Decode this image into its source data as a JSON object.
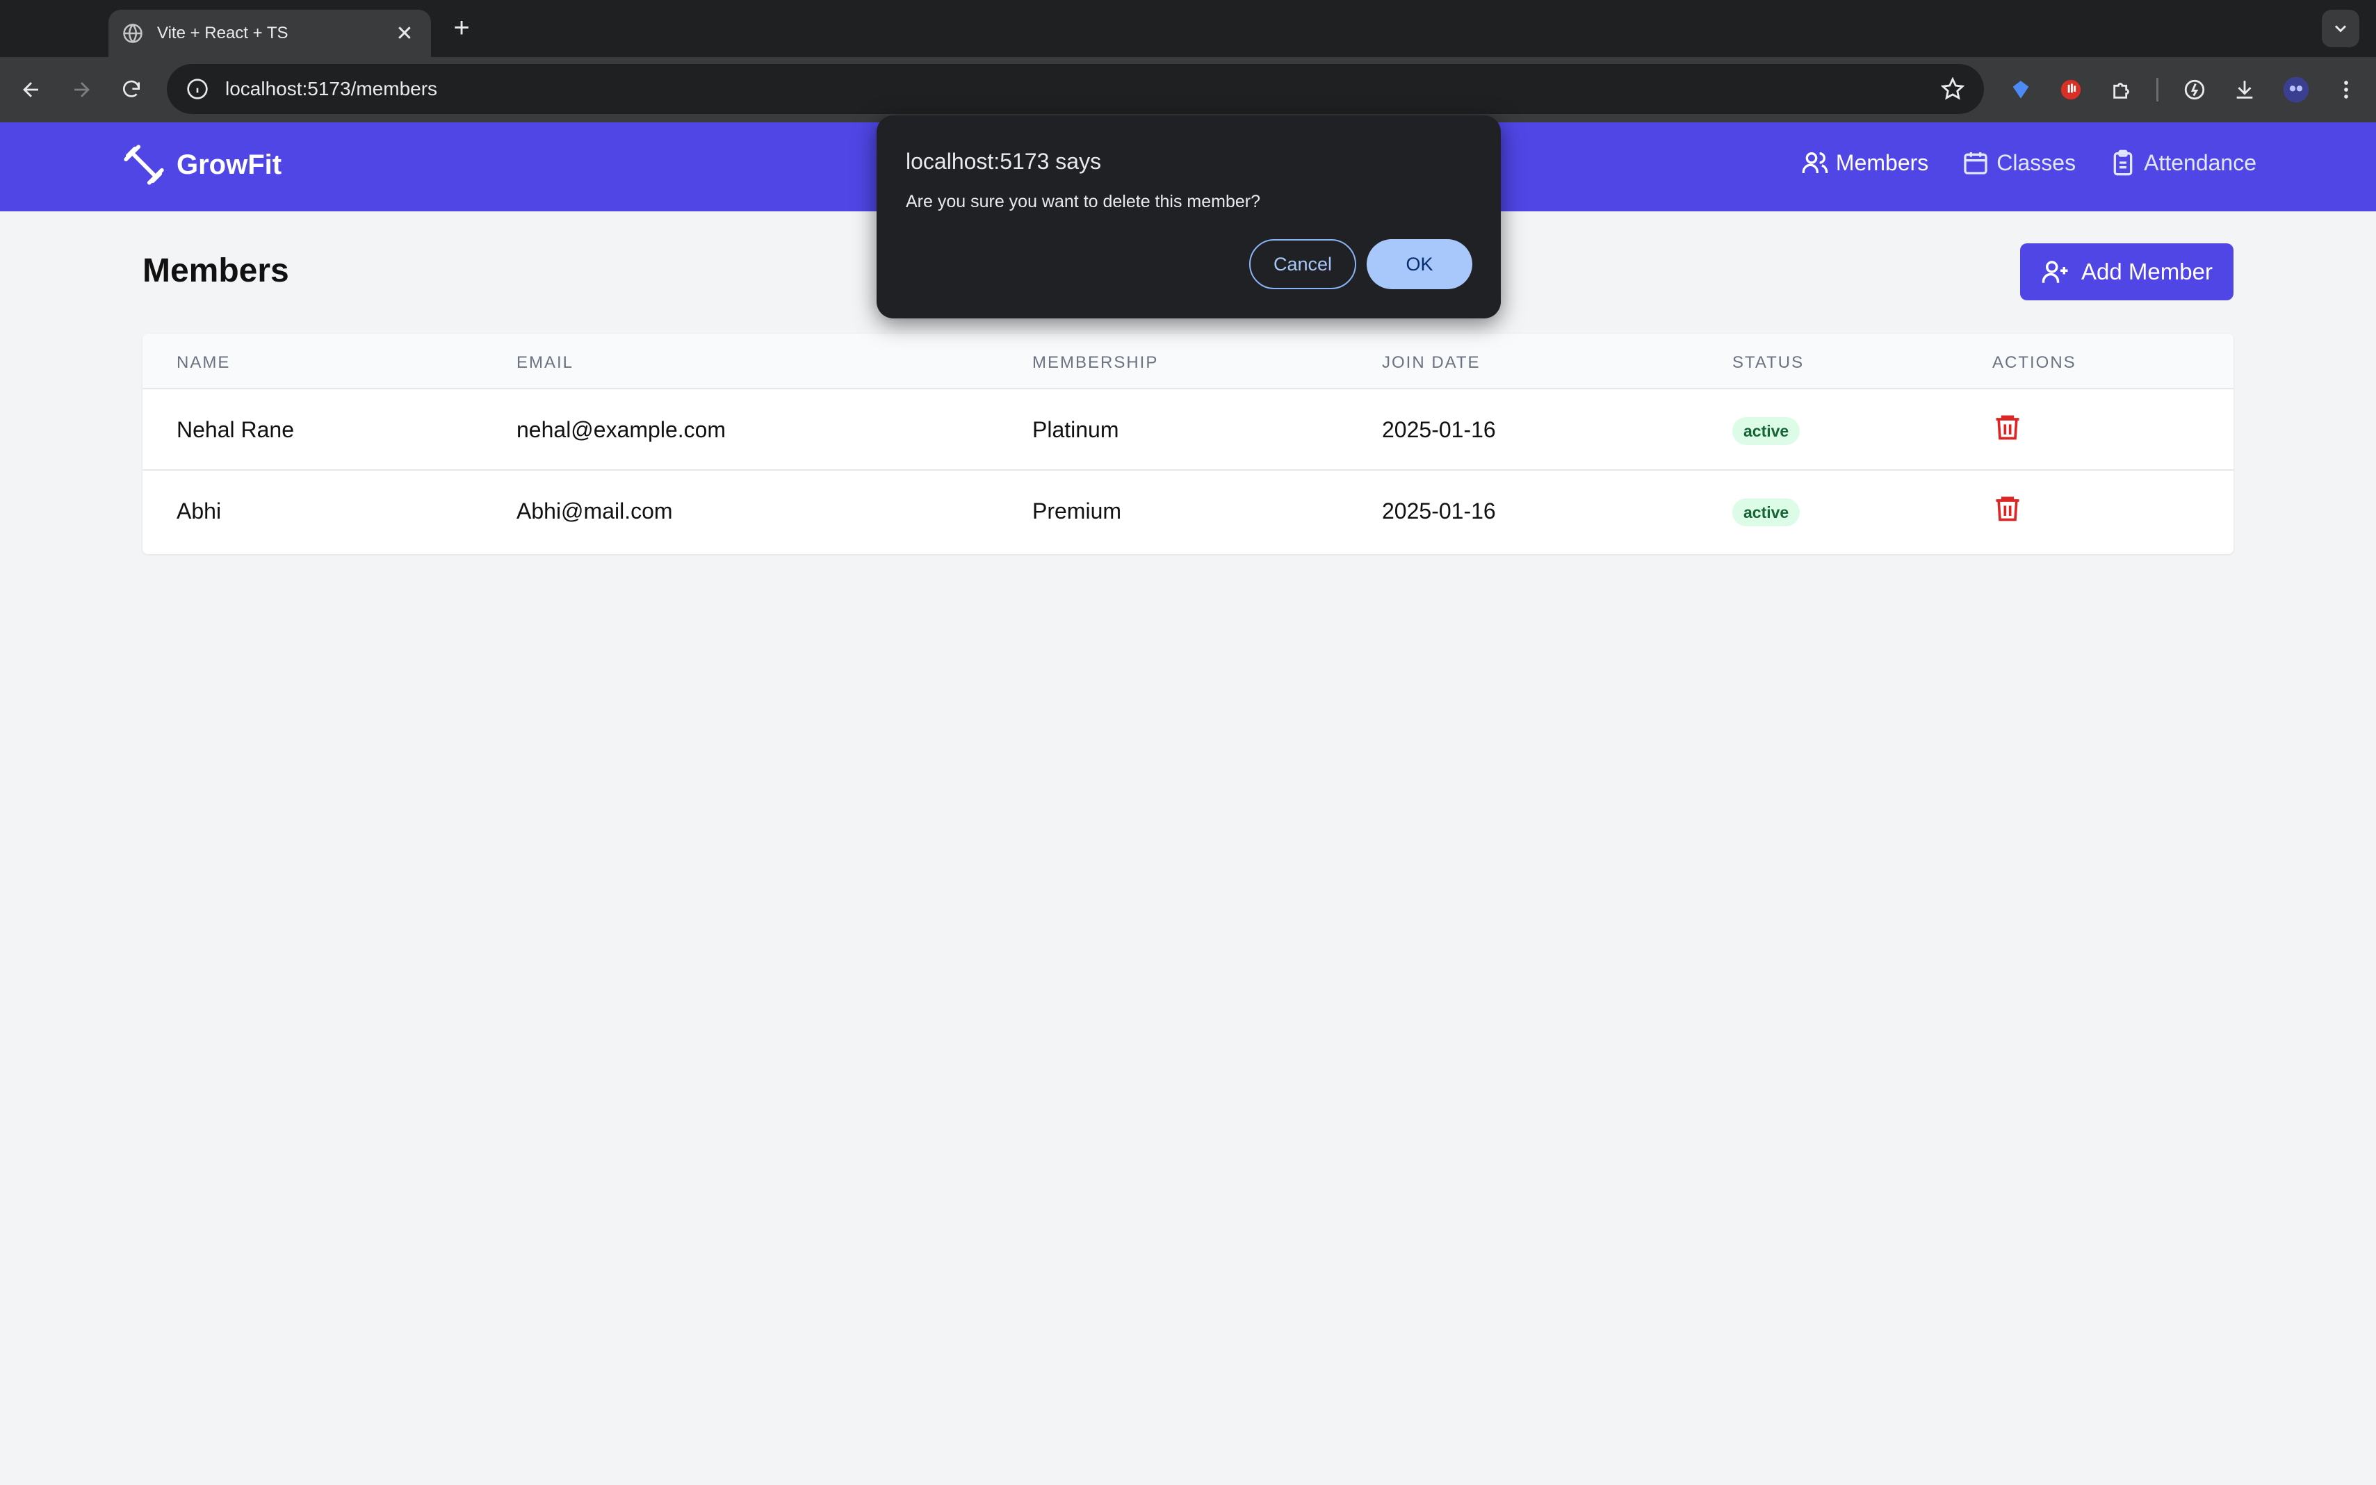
{
  "browser": {
    "tab_title": "Vite + React + TS",
    "url": "localhost:5173/members",
    "new_tab_label": "+",
    "tab_close_label": "✕"
  },
  "app": {
    "brand": "GrowFit",
    "nav": [
      {
        "label": "Members",
        "icon": "users-icon",
        "active": true
      },
      {
        "label": "Classes",
        "icon": "calendar-icon",
        "active": false
      },
      {
        "label": "Attendance",
        "icon": "clipboard-icon",
        "active": false
      }
    ],
    "accent_color": "#4f46e5"
  },
  "page": {
    "title": "Members",
    "add_button_label": "Add Member"
  },
  "table": {
    "headers": [
      "NAME",
      "EMAIL",
      "MEMBERSHIP",
      "JOIN DATE",
      "STATUS",
      "ACTIONS"
    ],
    "rows": [
      {
        "name": "Nehal Rane",
        "email": "nehal@example.com",
        "membership": "Platinum",
        "join_date": "2025-01-16",
        "status": "active"
      },
      {
        "name": "Abhi",
        "email": "Abhi@mail.com",
        "membership": "Premium",
        "join_date": "2025-01-16",
        "status": "active"
      }
    ]
  },
  "dialog": {
    "title": "localhost:5173 says",
    "message": "Are you sure you want to delete this member?",
    "cancel_label": "Cancel",
    "ok_label": "OK"
  }
}
